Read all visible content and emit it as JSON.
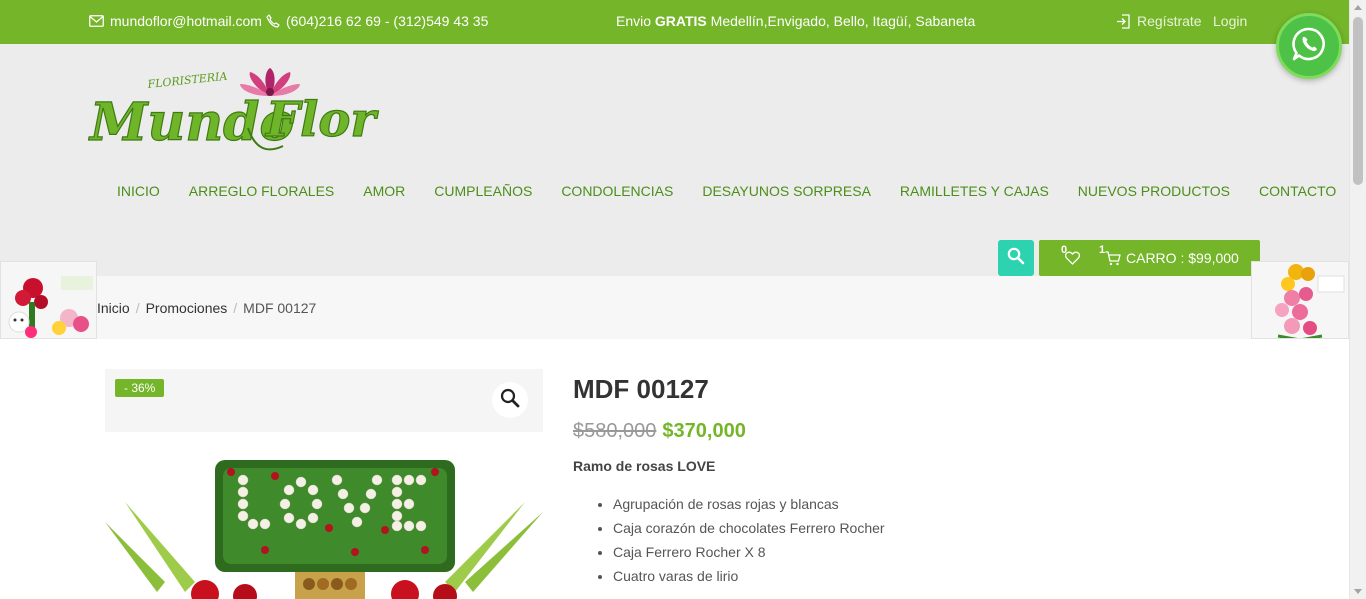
{
  "topbar": {
    "email": "mundoflor@hotmail.com",
    "phone": "(604)216 62 69 - (312)549 43 35",
    "shipping_prefix": "Envio ",
    "shipping_bold": "GRATIS",
    "shipping_rest": " Medellín,Envigado, Bello, Itagüí, Sabaneta",
    "register": "Regístrate",
    "login": "Login"
  },
  "logo": {
    "small": "FLORISTERIA",
    "word1": "Mundo",
    "word2": "Flor"
  },
  "nav": {
    "items": [
      {
        "label": "INICIO"
      },
      {
        "label": "ARREGLO FLORALES"
      },
      {
        "label": "AMOR"
      },
      {
        "label": "CUMPLEAÑOS"
      },
      {
        "label": "CONDOLENCIAS"
      },
      {
        "label": "DESAYUNOS SORPRESA"
      },
      {
        "label": "RAMILLETES Y CAJAS"
      },
      {
        "label": "NUEVOS PRODUCTOS"
      },
      {
        "label": "CONTACTO"
      }
    ]
  },
  "cart": {
    "wishlist_count": "0",
    "cart_count": "1",
    "label": "CARRO : $99,000"
  },
  "breadcrumb": {
    "home": "Inicio",
    "category": "Promociones",
    "current": "MDF 00127"
  },
  "product": {
    "badge": "- 36%",
    "title": "MDF 00127",
    "old_price": "$580,000",
    "new_price": "$370,000",
    "subtitle": "Ramo de rosas LOVE",
    "features": [
      "Agrupación de rosas rojas y blancas",
      "Caja corazón de chocolates Ferrero Rocher",
      "Caja Ferrero Rocher X 8",
      "Cuatro varas de lirio"
    ]
  },
  "colors": {
    "brand_green": "#74b529",
    "nav_green": "#4b8f1a",
    "search_teal": "#2dd3b0",
    "whatsapp_green": "#4dc247"
  },
  "icons": {
    "email": "envelope-icon",
    "phone": "phone-icon",
    "register": "sign-in-icon",
    "search": "search-icon",
    "wishlist": "heart-icon",
    "cart": "cart-icon",
    "zoom": "magnifier-icon",
    "whatsapp": "whatsapp-icon"
  }
}
